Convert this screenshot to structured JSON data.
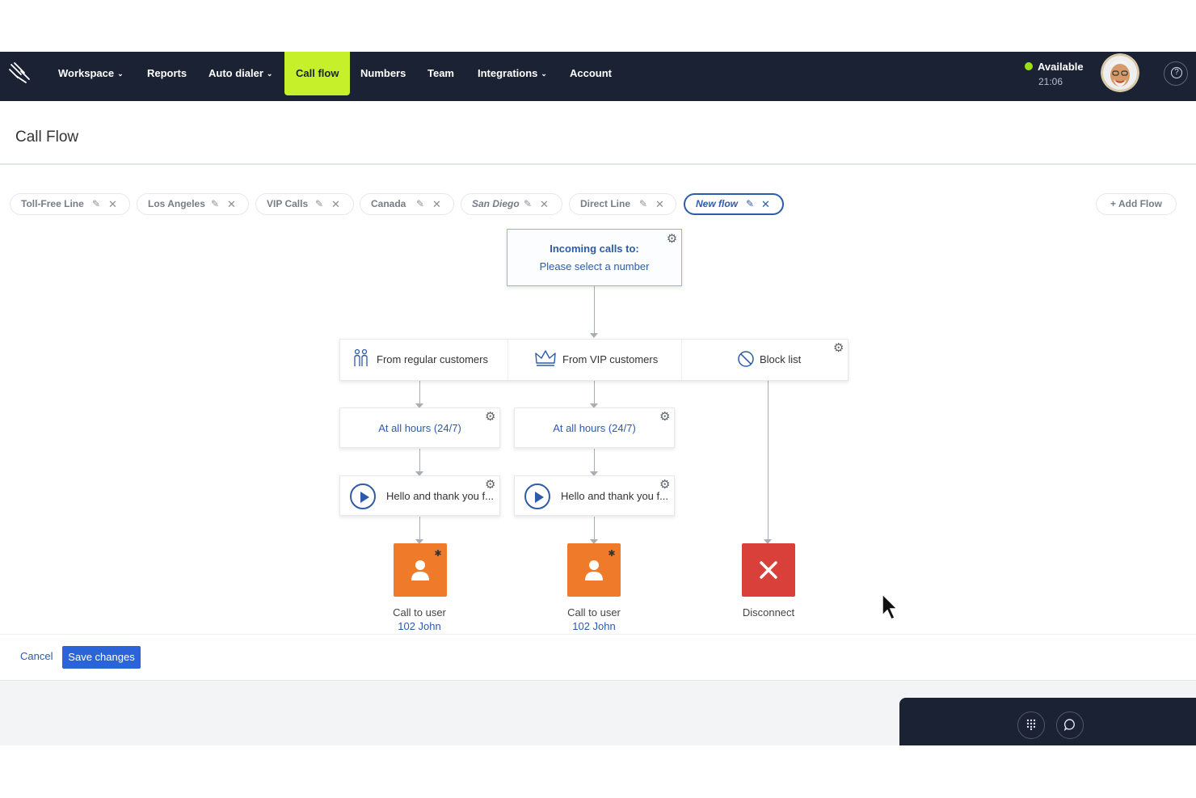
{
  "nav": {
    "items": [
      {
        "label": "Workspace",
        "has_dropdown": true
      },
      {
        "label": "Reports",
        "has_dropdown": false
      },
      {
        "label": "Auto dialer",
        "has_dropdown": true
      },
      {
        "label": "Call flow",
        "has_dropdown": false,
        "active": true
      },
      {
        "label": "Numbers",
        "has_dropdown": false
      },
      {
        "label": "Team",
        "has_dropdown": false
      },
      {
        "label": "Integrations",
        "has_dropdown": true
      },
      {
        "label": "Account",
        "has_dropdown": false
      }
    ],
    "status": {
      "label": "Available",
      "time": "21:06",
      "color": "#9ade1f"
    },
    "active_color": "#c6f02a",
    "bar_color": "#1a2233"
  },
  "page": {
    "title": "Call Flow"
  },
  "tabs": [
    {
      "label": "Toll-Free Line",
      "italic": false,
      "active": false
    },
    {
      "label": "Los Angeles",
      "italic": false,
      "active": false
    },
    {
      "label": "VIP Calls",
      "italic": false,
      "active": false
    },
    {
      "label": "Canada",
      "italic": false,
      "active": false
    },
    {
      "label": "San Diego",
      "italic": true,
      "active": false
    },
    {
      "label": "Direct Line",
      "italic": false,
      "active": false
    },
    {
      "label": "New flow",
      "italic": true,
      "active": true
    }
  ],
  "add_flow_label": "+ Add Flow",
  "flow": {
    "incoming": {
      "title": "Incoming calls to:",
      "subtitle": "Please select a number"
    },
    "branches": [
      {
        "label": "From regular customers",
        "icon": "people-icon"
      },
      {
        "label": "From VIP customers",
        "icon": "crown-icon"
      },
      {
        "label": "Block list",
        "icon": "block-icon"
      }
    ],
    "hours": [
      "At all hours (24/7)",
      "At all hours (24/7)"
    ],
    "messages": [
      "Hello and thank you f...",
      "Hello and thank you f..."
    ],
    "actions": [
      {
        "caption": "Call to user",
        "sub": "102 John",
        "type": "user"
      },
      {
        "caption": "Call to user",
        "sub": "102 John",
        "type": "user"
      },
      {
        "caption": "Disconnect",
        "sub": "",
        "type": "disconnect"
      }
    ]
  },
  "footer": {
    "cancel_label": "Cancel",
    "save_label": "Save changes"
  },
  "colors": {
    "accent_blue": "#2e5ba8",
    "save_blue": "#2b63d9",
    "user_orange": "#ee7a2a",
    "disconnect_red": "#d9403a"
  }
}
